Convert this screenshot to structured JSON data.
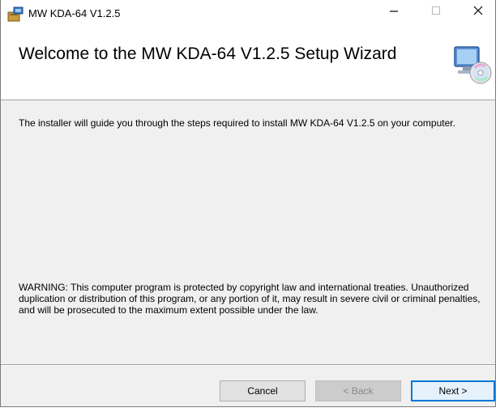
{
  "window": {
    "title": "MW KDA-64 V1.2.5",
    "controls": {
      "minimize": "minimize-icon",
      "maximize": "maximize-icon",
      "close": "close-icon"
    }
  },
  "header": {
    "title": "Welcome to the MW KDA-64 V1.2.5 Setup Wizard",
    "icon": "computer-disc-icon"
  },
  "body": {
    "intro": "The installer will guide you through the steps required to install MW KDA-64 V1.2.5 on your computer.",
    "warning": "WARNING: This computer program is protected by copyright law and international treaties. Unauthorized duplication or distribution of this program, or any portion of it, may result in severe civil or criminal penalties, and will be prosecuted to the maximum extent possible under the law."
  },
  "buttons": {
    "cancel": "Cancel",
    "back": "< Back",
    "next": "Next >"
  },
  "colors": {
    "window_bg": "#f0f0f0",
    "header_bg": "#ffffff",
    "default_button_border": "#0078d7"
  }
}
